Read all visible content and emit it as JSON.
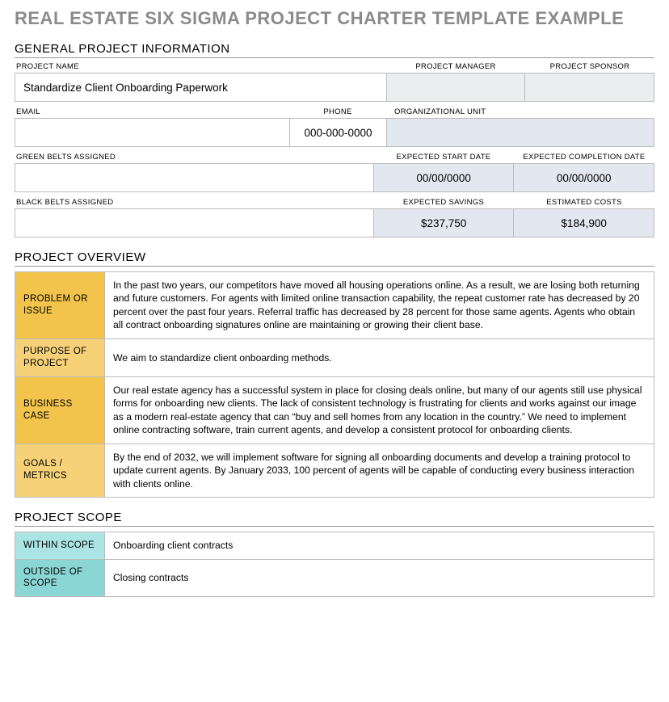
{
  "title": "REAL ESTATE SIX SIGMA PROJECT CHARTER TEMPLATE EXAMPLE",
  "sections": {
    "general": "GENERAL PROJECT INFORMATION",
    "overview": "PROJECT OVERVIEW",
    "scope": "PROJECT SCOPE"
  },
  "labels": {
    "project_name": "PROJECT NAME",
    "project_manager": "PROJECT MANAGER",
    "project_sponsor": "PROJECT SPONSOR",
    "email": "EMAIL",
    "phone": "PHONE",
    "org_unit": "ORGANIZATIONAL UNIT",
    "green_belts": "GREEN BELTS ASSIGNED",
    "expected_start": "EXPECTED START DATE",
    "expected_completion": "EXPECTED COMPLETION DATE",
    "black_belts": "BLACK BELTS ASSIGNED",
    "expected_savings": "EXPECTED SAVINGS",
    "estimated_costs": "ESTIMATED COSTS"
  },
  "values": {
    "project_name": "Standardize Client Onboarding Paperwork",
    "project_manager": "",
    "project_sponsor": "",
    "email": "",
    "phone": "000-000-0000",
    "org_unit": "",
    "green_belts": "",
    "expected_start": "00/00/0000",
    "expected_completion": "00/00/0000",
    "black_belts": "",
    "expected_savings": "$237,750",
    "estimated_costs": "$184,900"
  },
  "overview": {
    "problem_label": "PROBLEM OR ISSUE",
    "problem_text": "In the past two years, our competitors have moved all housing operations online. As a result, we are losing both returning and future customers. For agents with limited online transaction capability, the repeat customer rate has decreased by 20 percent over the past four years. Referral traffic has decreased by 28 percent for those same agents. Agents who obtain all contract onboarding signatures online are maintaining or growing their client base.",
    "purpose_label": "PURPOSE OF PROJECT",
    "purpose_text": "We aim to standardize client onboarding methods.",
    "business_label": "BUSINESS CASE",
    "business_text": "Our real estate agency has a successful system in place for closing deals online, but many of our agents still use physical forms for onboarding new clients. The lack of consistent technology is frustrating for clients and works against our image as a modern real-estate agency that can “buy and sell homes from any location in the country.” We need to implement online contracting software, train current agents, and develop a consistent protocol for onboarding clients.",
    "goals_label": "GOALS / METRICS",
    "goals_text": "By the end of 2032, we will implement software for signing all onboarding documents and develop a training protocol to update current agents. By January 2033, 100 percent of agents will be capable of conducting every business interaction with clients online."
  },
  "scope": {
    "within_label": "WITHIN SCOPE",
    "within_text": "Onboarding client contracts",
    "outside_label": "OUTSIDE OF SCOPE",
    "outside_text": "Closing contracts"
  }
}
